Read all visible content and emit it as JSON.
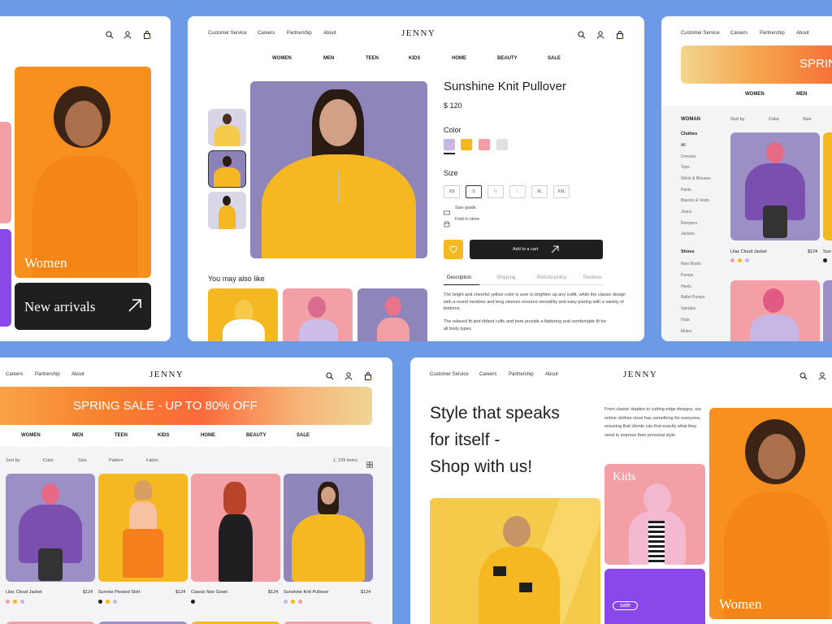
{
  "brand": "JENNY",
  "topnav": [
    "Customer Service",
    "Careers",
    "Partnership",
    "About"
  ],
  "catnav": [
    "WOMEN",
    "MEN",
    "TEEN",
    "KIDS",
    "HOME",
    "BEAUTY",
    "SALE"
  ],
  "colors": {
    "background": "#6b9be6",
    "orange": "#f7901e",
    "yellow": "#f5b820",
    "pink": "#f29fa6",
    "lilac": "#c7b6e6",
    "purple": "#8b47e8",
    "dark": "#1f1f22"
  },
  "left_card": {
    "women_label": "Women",
    "new_arrivals": "New arrivals"
  },
  "product": {
    "name": "Sunshine Knit Pullover",
    "price": "$ 120",
    "color_label": "Color",
    "swatches": [
      "#c7b6e6",
      "#f5b820",
      "#f29fa6",
      "#e1e1e1"
    ],
    "size_label": "Size",
    "sizes": [
      "XS",
      "S",
      "M",
      "L",
      "XL",
      "XXL"
    ],
    "selected_size": "S",
    "size_guide": "Size guide",
    "find_store": "Find in store",
    "add_to_cart": "Add to a cart",
    "tabs": [
      "Description",
      "Shipping",
      "Refund policy",
      "Reviews"
    ],
    "desc1": "The bright and cheerful yellow color is sure to brighten up any outfit, while the classic design with a round neckline and long sleeves ensures versatility and easy pairing with a variety of bottoms.",
    "desc2": "The relaxed fit and ribbed cuffs and hem provide a flattering and comfortable fit for all body types.",
    "also_like": "You may also like"
  },
  "right_card": {
    "banner": "SPRIN",
    "nav": [
      "WOMEN",
      "MEN"
    ],
    "section": "WOMAN",
    "filters": [
      "Sort by",
      "Color",
      "Size"
    ],
    "category": "Clothes",
    "subcats": [
      "All",
      "Dresses",
      "Tops",
      "Shirts & Blouses",
      "Pants",
      "Blazers & Vests",
      "Jeans",
      "Rompers",
      "Jackets"
    ],
    "category2": "Shoes",
    "subcats2": [
      "Rain Boots",
      "Pumps",
      "Heels",
      "Ballet Pumps",
      "Sandals",
      "Flats",
      "Mules"
    ],
    "item_name": "Lilac Cloud Jacket",
    "item_price": "$124",
    "item2_cut": "Sun"
  },
  "bottom_left": {
    "topnav": [
      "Careers",
      "Partnership",
      "About"
    ],
    "banner": "SPRING SALE - UP TO 80% OFF",
    "filters": [
      "Sort by",
      "Color",
      "Size",
      "Pattern",
      "Fabric"
    ],
    "count": "1, 239 items",
    "products": [
      {
        "name": "Lilac Cloud Jacket",
        "price": "$124",
        "dots": [
          "#f29fa6",
          "#f5b820",
          "#c7b6e6"
        ]
      },
      {
        "name": "Sunrise Pleated Skirt",
        "price": "$124",
        "dots": [
          "#1f1f22",
          "#f5b820",
          "#c7b6e6"
        ]
      },
      {
        "name": "Classic Noir Gown",
        "price": "$124",
        "dots": [
          "#1f1f22"
        ]
      },
      {
        "name": "Sunshine Knit Pullover",
        "price": "$124",
        "dots": [
          "#c7b6e6",
          "#f5b820",
          "#f29fa6"
        ]
      }
    ]
  },
  "bottom_right": {
    "headline1": "Style that speaks",
    "headline2": "for itself -",
    "headline3": "Shop with us!",
    "intro": "From classic staples to cutting-edge designs, our online clothes store has something for everyone, ensuring that clients can find exactly what they need to express their personal style.",
    "kids": "Kids",
    "women": "Women",
    "sale_tag": "sale"
  }
}
